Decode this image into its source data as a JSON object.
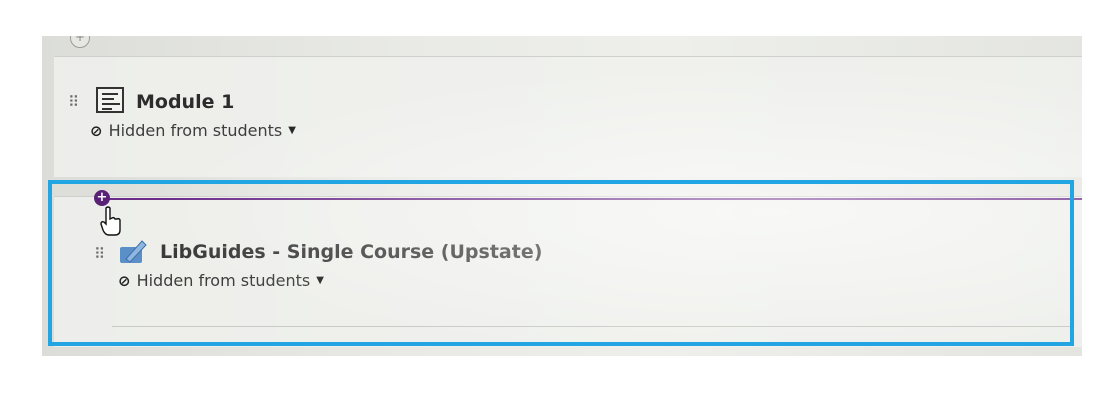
{
  "modules": [
    {
      "title": "Module 1",
      "visibility": "Hidden from students",
      "icon": "module-icon"
    },
    {
      "title": "LibGuides - Single Course (Upstate)",
      "visibility": "Hidden from students",
      "icon": "external-tool-icon"
    }
  ],
  "colors": {
    "highlight": "#22a6e3",
    "insert_accent": "#5a2277"
  }
}
